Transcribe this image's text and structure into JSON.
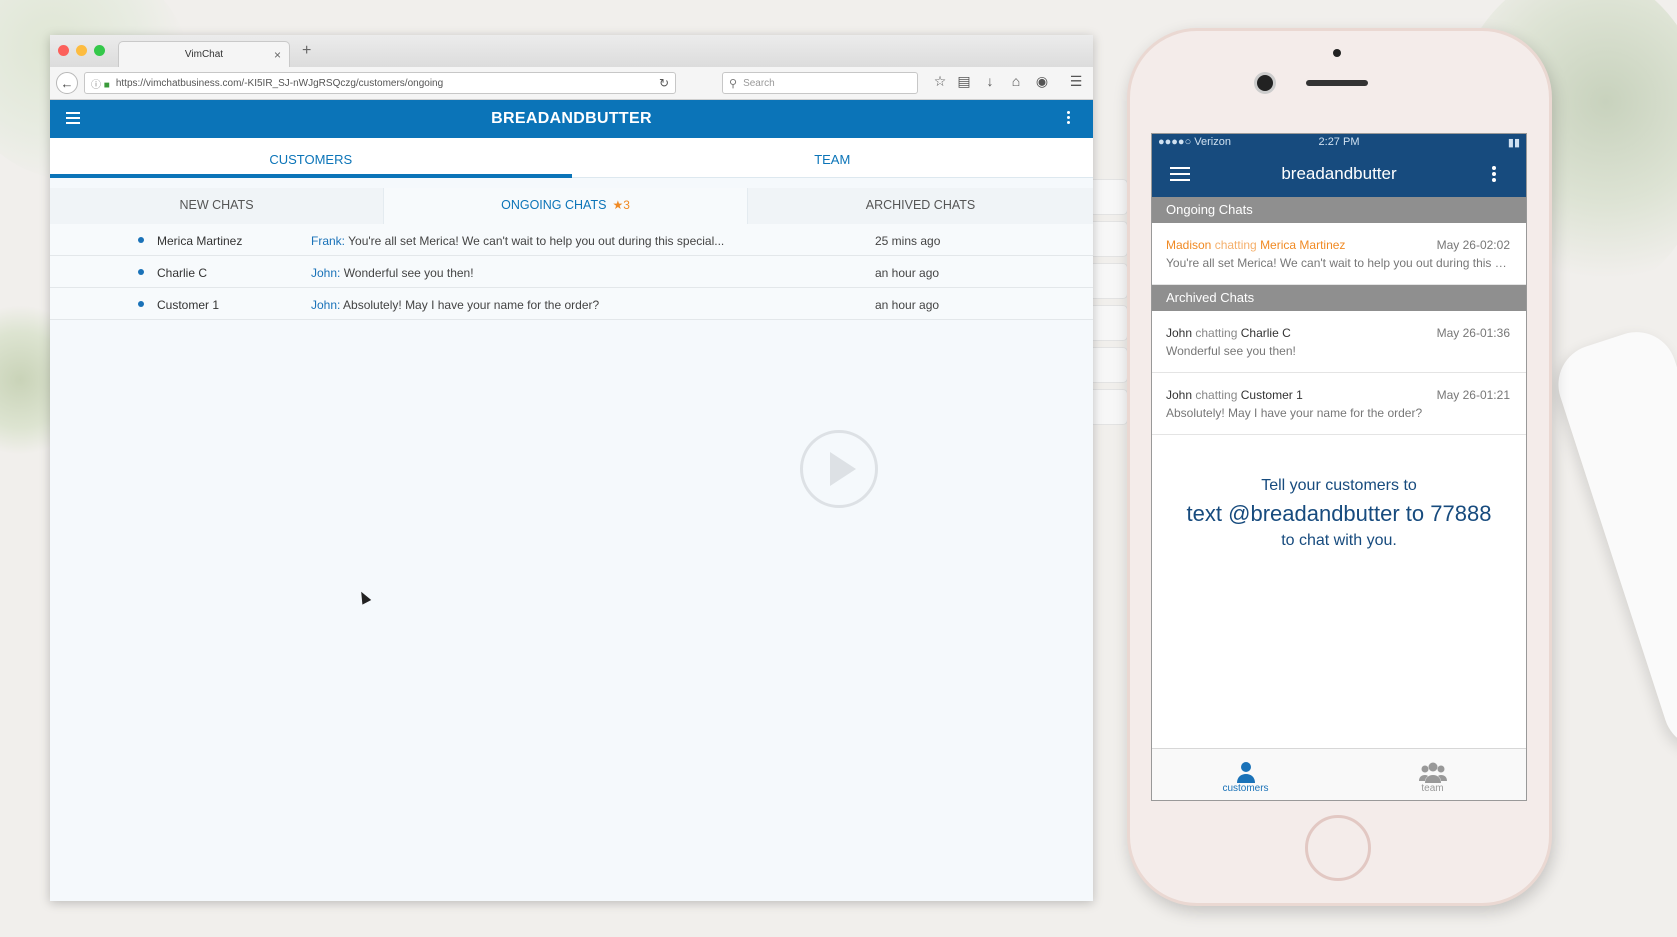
{
  "browser": {
    "tab_title": "VimChat",
    "tab_close": "×",
    "new_tab": "+",
    "url": "https://vimchatbusiness.com/-KI5IR_SJ-nWJgRSQczg/customers/ongoing",
    "search_placeholder": "Search"
  },
  "app": {
    "brand": "BREADANDBUTTER",
    "main_tabs": [
      "CUSTOMERS",
      "TEAM"
    ],
    "sub_tabs": {
      "new": "NEW CHATS",
      "ongoing": "ONGOING CHATS",
      "ongoing_badge": "★3",
      "archived": "ARCHIVED CHATS"
    },
    "chats": [
      {
        "name": "Merica Martinez",
        "agent": "Frank:",
        "message": " You're all set Merica! We can't wait to help you out during this special...",
        "time": "25 mins ago"
      },
      {
        "name": "Charlie C",
        "agent": "John:",
        "message": " Wonderful see you then!",
        "time": "an hour ago"
      },
      {
        "name": "Customer 1",
        "agent": "John:",
        "message": " Absolutely! May I have your name for the order?",
        "time": "an hour ago"
      }
    ]
  },
  "phone": {
    "carrier": "●●●●○ Verizon",
    "time": "2:27 PM",
    "header_title": "breadandbutter",
    "ongoing_header": "Ongoing Chats",
    "archived_header": "Archived Chats",
    "ongoing_items": [
      {
        "agent": "Madison",
        "verb": " chatting ",
        "customer": "Merica Martinez",
        "date": "May 26-02:02",
        "snippet": "You're all set Merica! We can't wait to help you out during this sp..."
      }
    ],
    "archived_items": [
      {
        "agent": "John",
        "verb": " chatting ",
        "customer": "Charlie C",
        "date": "May 26-01:36",
        "snippet": "Wonderful see you then!"
      },
      {
        "agent": "John",
        "verb": " chatting ",
        "customer": "Customer 1",
        "date": "May 26-01:21",
        "snippet": "Absolutely! May I have your name for the order?"
      }
    ],
    "promo": {
      "line1": "Tell your customers to",
      "line2": "text @breadandbutter to 77888",
      "line3": "to chat with you."
    },
    "bottom_tabs": [
      "customers",
      "team"
    ]
  },
  "colors": {
    "brand_blue": "#0b74b8",
    "phone_navy": "#174b7e",
    "accent_orange": "#f08a24"
  }
}
